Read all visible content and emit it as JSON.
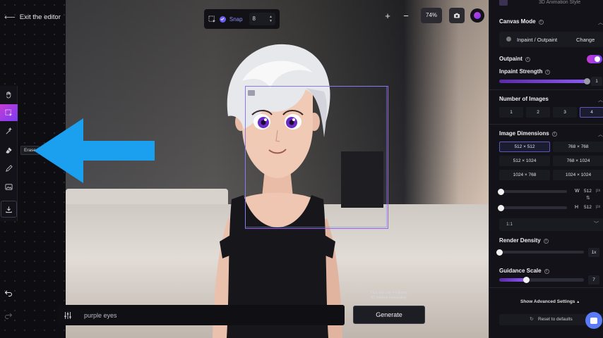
{
  "header": {
    "exit_label": "Exit the editor"
  },
  "toolbar": {
    "tools": [
      "hand-icon",
      "select-area-icon",
      "magic-brush-icon",
      "eraser-icon",
      "pencil-icon",
      "image-icon",
      "download-icon"
    ],
    "active_tool": "select-area-icon",
    "tooltip": "Erase"
  },
  "snap": {
    "label": "Snap",
    "value": "8",
    "enabled": true
  },
  "zoom": {
    "plus": "+",
    "minus": "−",
    "level": "74%"
  },
  "prompt": {
    "text": "purple eyes"
  },
  "generate": {
    "label": "Generate",
    "token_line1": "This will use 4 tokens.",
    "token_line2": "87 tokens remaining."
  },
  "panel": {
    "style_name": "3D Animation Style",
    "canvas_mode": {
      "title": "Canvas Mode",
      "value": "Inpaint / Outpaint",
      "change_label": "Change"
    },
    "outpaint": {
      "label": "Outpaint",
      "enabled": true
    },
    "inpaint_strength": {
      "label": "Inpaint Strength",
      "value": "1",
      "fraction": 1.0
    },
    "num_images": {
      "title": "Number of Images",
      "options": [
        "1",
        "2",
        "3",
        "4"
      ],
      "selected": "4"
    },
    "dimensions": {
      "title": "Image Dimensions",
      "options": [
        "512 × 512",
        "768 × 768",
        "512 × 1024",
        "768 × 1024",
        "1024 × 768",
        "1024 × 1024"
      ],
      "selected": "512 × 512",
      "w_label": "W",
      "w_value": "512",
      "h_label": "H",
      "h_value": "512",
      "unit": "px",
      "aspect": "1:1"
    },
    "render_density": {
      "label": "Render Density",
      "value": "1x",
      "fraction": 0.0
    },
    "guidance_scale": {
      "label": "Guidance Scale",
      "value": "7",
      "fraction": 0.32
    },
    "advanced_label": "Show Advanced Settings",
    "reset_label": "Reset to defaults"
  },
  "colors": {
    "accent": "#8a5af0",
    "active_tool": "#c43bd6",
    "blue_arrow": "#1ba0f0"
  }
}
